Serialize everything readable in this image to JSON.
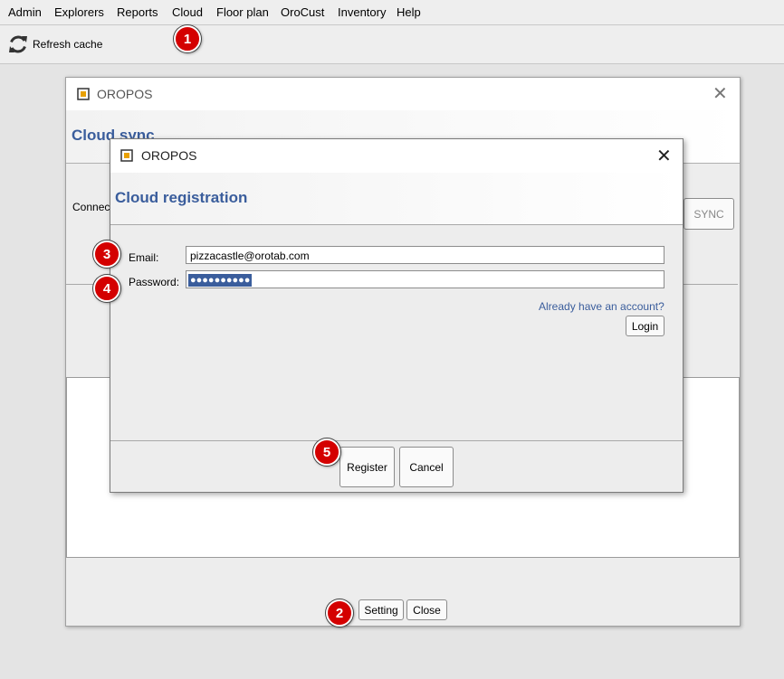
{
  "menubar": {
    "items": [
      "Admin",
      "Explorers",
      "Reports",
      "Cloud",
      "Floor plan",
      "OroCust",
      "Inventory",
      "Help"
    ]
  },
  "toolbar": {
    "refresh_label": "Refresh cache",
    "refresh_icon": "refresh-icon"
  },
  "badges": [
    "1",
    "2",
    "3",
    "4",
    "5"
  ],
  "colors": {
    "accent": "#3a5d9c",
    "badge": "#d40000",
    "app_icon": "#e8a000"
  },
  "cloud_sync_dialog": {
    "window_title": "OROPOS",
    "header": "Cloud sync",
    "connection_label": "Connec",
    "sync_button": "SYNC",
    "setting_button": "Setting",
    "close_button": "Close"
  },
  "registration_dialog": {
    "window_title": "OROPOS",
    "header": "Cloud registration",
    "email_label": "Email:",
    "email_value": "pizzacastle@orotab.com",
    "password_label": "Password:",
    "password_value": "●●●●●●●●●●",
    "already_link": "Already have an account?",
    "login_button": "Login",
    "register_button": "Register",
    "cancel_button": "Cancel"
  }
}
